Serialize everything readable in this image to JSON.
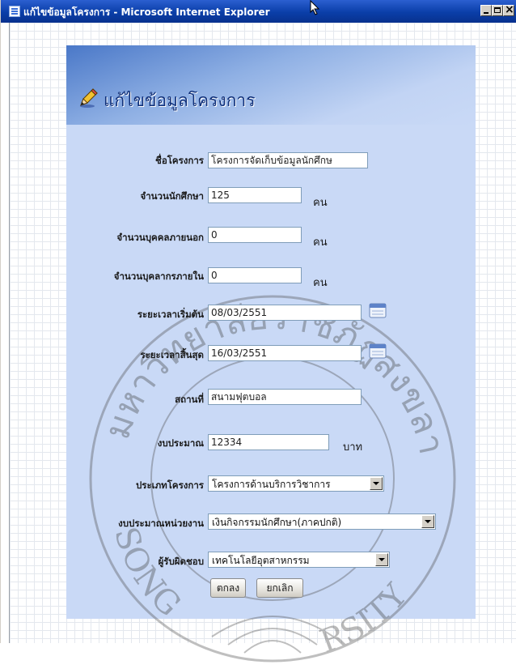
{
  "window": {
    "title": "แก้ไขข้อมูลโครงการ - Microsoft Internet Explorer"
  },
  "form": {
    "title": "แก้ไขข้อมูลโครงการ",
    "fields": {
      "project_name": {
        "label": "ชื่อโครงการ",
        "value": "โครงการจัดเก็บข้อมูลนักศึกษ"
      },
      "students": {
        "label": "จำนวนนักศึกษา",
        "value": "125",
        "unit": "คน"
      },
      "external_people": {
        "label": "จำนวนบุคคลภายนอก",
        "value": "0",
        "unit": "คน"
      },
      "internal_staff": {
        "label": "จำนวนบุคลากรภายใน",
        "value": "0",
        "unit": "คน"
      },
      "start_date": {
        "label": "ระยะเวลาเริ่มต้น",
        "value": "08/03/2551"
      },
      "end_date": {
        "label": "ระยะเวลาสิ้นสุด",
        "value": "16/03/2551"
      },
      "location": {
        "label": "สถานที่",
        "value": "สนามฟุตบอล"
      },
      "budget": {
        "label": "งบประมาณ",
        "value": "12334",
        "unit": "บาท"
      },
      "project_type": {
        "label": "ประเภทโครงการ",
        "selected": "โครงการด้านบริการวิชาการ"
      },
      "unit_budget": {
        "label": "งบประมาณหน่วยงาน",
        "selected": "เงินกิจกรรมนักศึกษา(ภาคปกติ)"
      },
      "responsible": {
        "label": "ผู้รับผิดชอบ",
        "selected": "เทคโนโลยีอุตสาหกรรม"
      }
    },
    "buttons": {
      "ok": "ตกลง",
      "cancel": "ยกเลิก"
    }
  },
  "watermark": {
    "text_top": "มหาวิทยาลัยราชภัฏสงขลา",
    "text_bottom_left": "SONG",
    "text_bottom_right": "RSITY"
  },
  "icons": {
    "pencil": "pencil-icon",
    "calendar": "calendar-icon",
    "window": "ie-page-icon"
  }
}
